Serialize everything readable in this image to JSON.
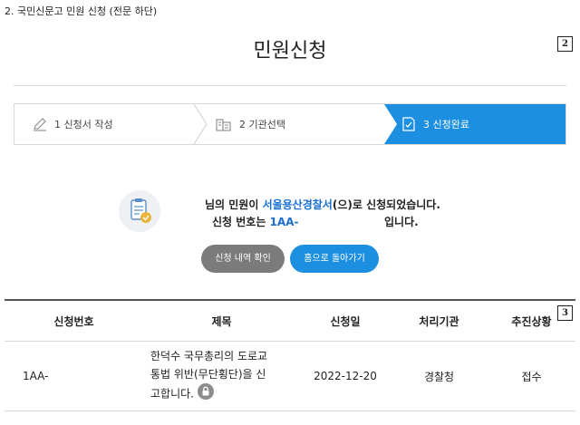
{
  "caption": "2. 국민신문고 민원 신청 (전문 하단)",
  "page_title": "민원신청",
  "badges": {
    "title_badge": "2",
    "table_badge": "3"
  },
  "steps": [
    {
      "label": "1 신청서 작성",
      "icon": "pencil-icon"
    },
    {
      "label": "2 기관선택",
      "icon": "building-icon"
    },
    {
      "label": "3 신청완료",
      "icon": "check-document-icon"
    }
  ],
  "message": {
    "line1_prefix": "님의 민원이 ",
    "agency": "서울용산경찰서",
    "line1_suffix": "(으)로 신청되었습니다.",
    "line2_prefix": "신청 번호는 ",
    "number": "1AA-",
    "line2_suffix": "입니다."
  },
  "buttons": {
    "history": "신청 내역 확인",
    "home": "홈으로 돌아가기"
  },
  "table": {
    "headers": [
      "신청번호",
      "제목",
      "신청일",
      "처리기관",
      "추진상황"
    ],
    "row": {
      "number": "1AA-",
      "subject_lines": [
        "한덕수 국무총리의 도로교",
        "통법 위반(무단횡단)을 신",
        "고합니다."
      ],
      "date": "2022-12-20",
      "agency": "경찰청",
      "status": "접수"
    }
  },
  "colors": {
    "accent": "#1c8fe0",
    "link": "#1a6fd1",
    "gray_button": "#7b7b7b"
  }
}
